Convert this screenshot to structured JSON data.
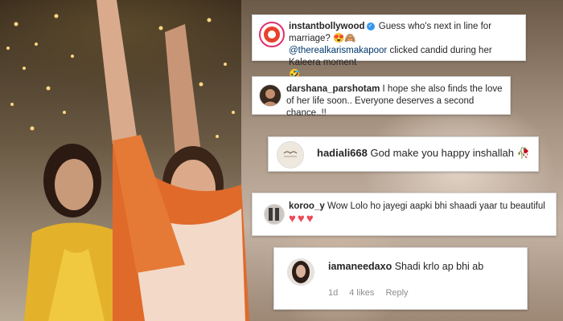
{
  "comments": [
    {
      "username": "instantbollywood",
      "verified": true,
      "text": "Guess who's next in line for marriage?",
      "emoji1": "😍🙈",
      "mention": "@therealkarismakapoor",
      "text2": " clicked candid during her Kaleera moment",
      "emoji2": "🤣"
    },
    {
      "username": "darshana_parshotam",
      "text": "I hope she also finds the love of her life soon.. Everyone deserves a second chance..!!"
    },
    {
      "username": "hadiali668",
      "text": "God make you happy inshallah",
      "emoji": "🥀"
    },
    {
      "username": "koroo_y",
      "text": "Wow Lolo ho jayegi aapki bhi shaadi yaar tu beautiful",
      "emoji": "♥♥♥"
    },
    {
      "username": "iamaneedaxo",
      "text": "Shadi krlo ap bhi ab",
      "time": "1d",
      "likes": "4 likes",
      "reply": "Reply"
    }
  ],
  "colors": {
    "accent": "#3897f0",
    "heart": "#ed4956",
    "username": "#262626",
    "meta": "#8e8e8e"
  }
}
